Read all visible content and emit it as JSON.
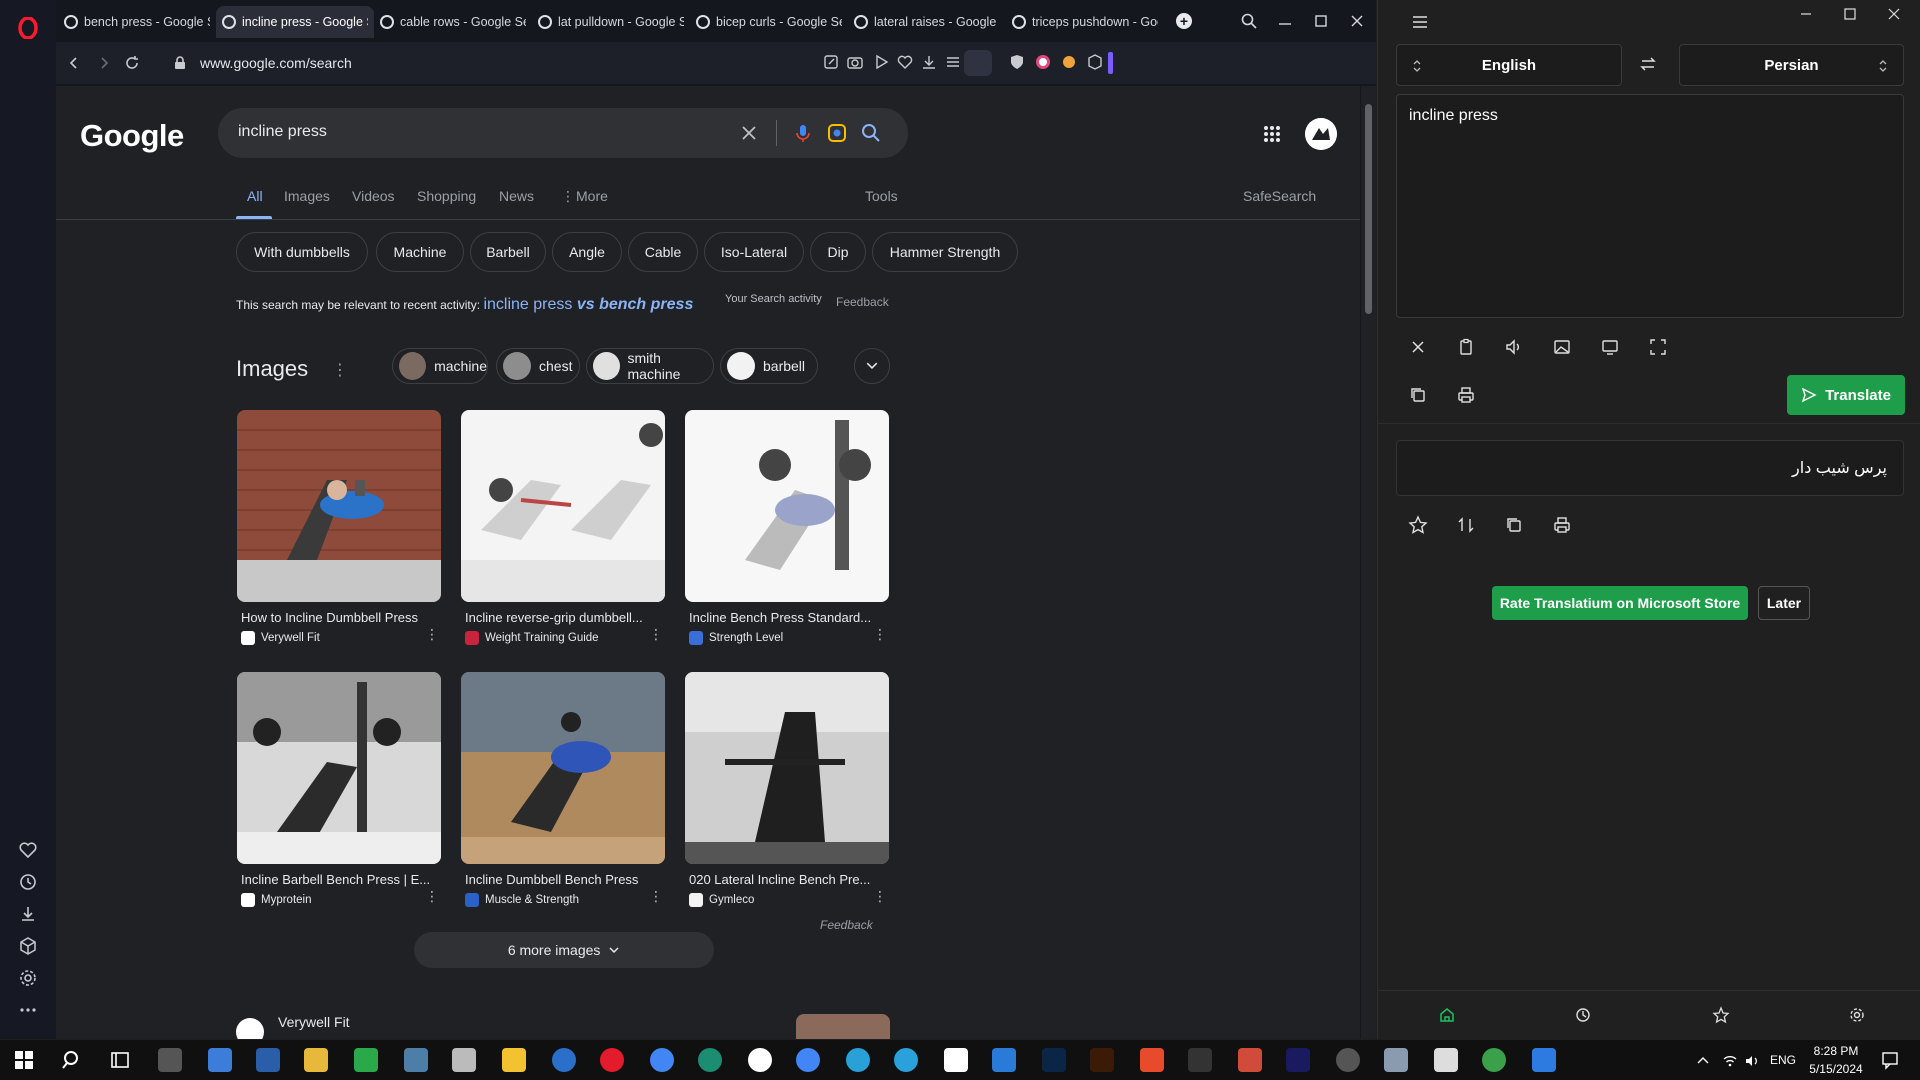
{
  "browser": {
    "tabs": [
      {
        "label": "bench press - Google Se"
      },
      {
        "label": "incline press - Google Sea"
      },
      {
        "label": "cable rows - Google Sea"
      },
      {
        "label": "lat pulldown - Google S"
      },
      {
        "label": "bicep curls - Google Se"
      },
      {
        "label": "lateral raises - Google S"
      },
      {
        "label": "triceps pushdown - Goo"
      }
    ],
    "url": "www.google.com/search"
  },
  "google": {
    "logo": "Google",
    "query": "incline press",
    "nav_tabs": [
      "All",
      "Images",
      "Videos",
      "Shopping",
      "News",
      "More"
    ],
    "tools": "Tools",
    "safesearch": "SafeSearch",
    "chips": [
      "With dumbbells",
      "Machine",
      "Barbell",
      "Angle",
      "Cable",
      "Iso-Lateral",
      "Dip",
      "Hammer Strength"
    ],
    "recent_prefix": "This search may be relevant to recent activity:",
    "recent_query": "incline press",
    "recent_query_bold": "vs bench press",
    "search_activity": "Your Search activity",
    "feedback": "Feedback",
    "images_title": "Images",
    "image_chips": [
      "machine",
      "chest",
      "smith machine",
      "barbell"
    ],
    "image_results": [
      {
        "caption": "How to Incline Dumbbell Press",
        "source": "Verywell Fit"
      },
      {
        "caption": "Incline reverse-grip dumbbell...",
        "source": "Weight Training Guide"
      },
      {
        "caption": "Incline Bench Press Standard...",
        "source": "Strength Level"
      },
      {
        "caption": "Incline Barbell Bench Press | E...",
        "source": "Myprotein"
      },
      {
        "caption": "Incline Dumbbell Bench Press",
        "source": "Muscle & Strength"
      },
      {
        "caption": "020 Lateral Incline Bench Pre...",
        "source": "Gymleco"
      }
    ],
    "images_feedback": "Feedback",
    "more_images": "6 more images",
    "result_site": "Verywell Fit"
  },
  "translator": {
    "source_lang": "English",
    "target_lang": "Persian",
    "input": "incline press",
    "translate_label": "Translate",
    "output": "پرس شیب دار",
    "rate_label": "Rate Translatium on Microsoft Store",
    "later_label": "Later"
  },
  "taskbar": {
    "lang": "ENG",
    "time": "8:28 PM",
    "date": "5/15/2024"
  }
}
